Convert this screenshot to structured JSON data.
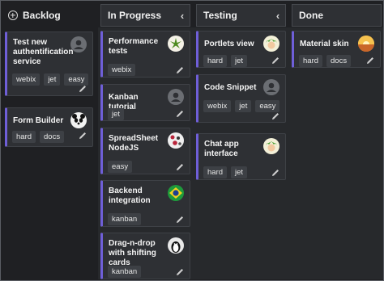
{
  "columns": [
    {
      "id": "backlog",
      "title": "Backlog"
    },
    {
      "id": "inprogress",
      "title": "In Progress"
    },
    {
      "id": "testing",
      "title": "Testing"
    },
    {
      "id": "done",
      "title": "Done"
    }
  ],
  "cards": {
    "backlog": [
      {
        "title": "Test new authentification service",
        "tags": [
          "webix",
          "jet",
          "easy"
        ],
        "avatar": "generic-user"
      },
      {
        "title": "Form Builder",
        "tags": [
          "hard",
          "docs"
        ],
        "avatar": "panda"
      }
    ],
    "inprogress": [
      {
        "title": "Performance tests",
        "tags": [
          "webix"
        ],
        "avatar": "leaf"
      },
      {
        "title": "Kanban tutorial",
        "tags": [
          "jet"
        ],
        "avatar": "generic-user"
      },
      {
        "title": "SpreadSheet NodeJS",
        "tags": [
          "easy"
        ],
        "avatar": "dots"
      },
      {
        "title": "Backend integration",
        "tags": [
          "kanban"
        ],
        "avatar": "brazil-flag"
      },
      {
        "title": "Drag-n-drop with shifting cards",
        "tags": [
          "kanban"
        ],
        "avatar": "penguin"
      }
    ],
    "testing": [
      {
        "title": "Portlets view",
        "tags": [
          "hard",
          "jet"
        ],
        "avatar": "cartoon"
      },
      {
        "title": "Code Snippet",
        "tags": [
          "webix",
          "jet",
          "easy"
        ],
        "avatar": "generic-user"
      },
      {
        "title": "Chat app interface",
        "tags": [
          "hard",
          "jet"
        ],
        "avatar": "cartoon"
      }
    ],
    "done": [
      {
        "title": "Material skin",
        "tags": [
          "hard",
          "docs"
        ],
        "avatar": "sunset"
      }
    ]
  },
  "colors": {
    "accent": "#6f5fd8",
    "background": "#1f2023",
    "card": "#2e3034",
    "tag": "#3d4045"
  },
  "icons": {
    "add": "plus-circle-icon",
    "collapse": "chevron-left-icon",
    "edit": "pencil-icon"
  }
}
